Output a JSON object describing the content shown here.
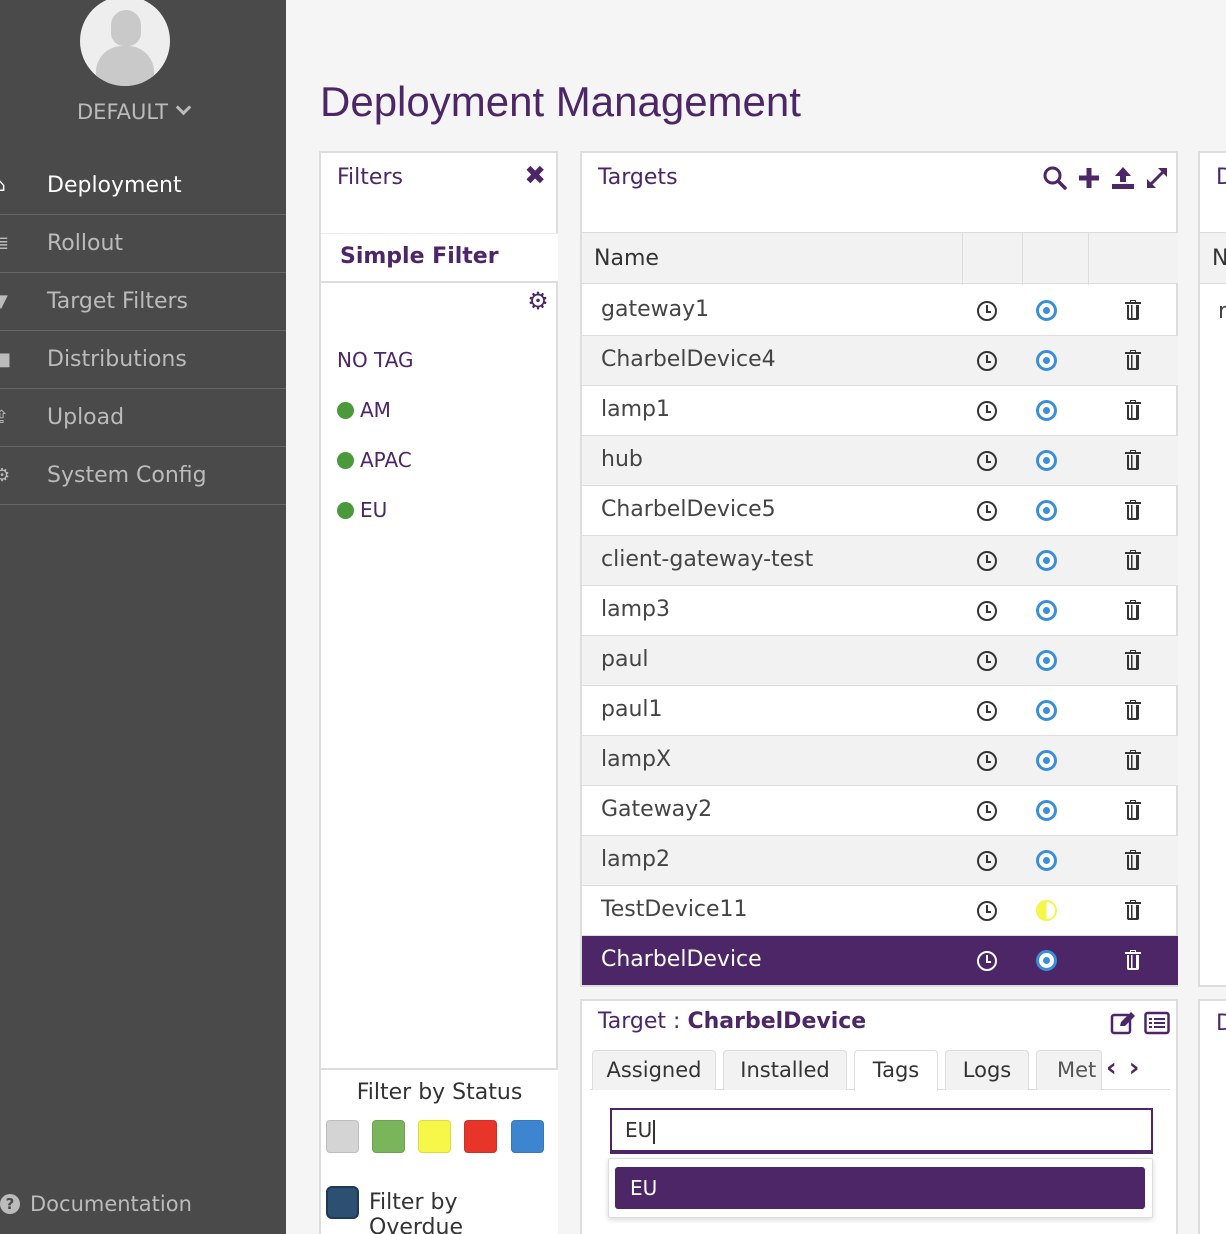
{
  "sidebar": {
    "tenant": "DEFAULT",
    "nav": [
      {
        "label": "Deployment",
        "icon": "home-icon",
        "active": true
      },
      {
        "label": "Rollout",
        "icon": "list-icon",
        "active": false
      },
      {
        "label": "Target Filters",
        "icon": "filter-icon",
        "active": false
      },
      {
        "label": "Distributions",
        "icon": "briefcase-icon",
        "active": false
      },
      {
        "label": "Upload",
        "icon": "upload-icon",
        "active": false
      },
      {
        "label": "System Config",
        "icon": "gear-icon",
        "active": false
      }
    ],
    "documentation": "Documentation"
  },
  "page": {
    "title": "Deployment Management"
  },
  "filters": {
    "title": "Filters",
    "tab": "Simple Filter",
    "tags": [
      {
        "label": "NO TAG",
        "color": null
      },
      {
        "label": "AM",
        "color": "#4a9a3b"
      },
      {
        "label": "APAC",
        "color": "#4a9a3b"
      },
      {
        "label": "EU",
        "color": "#4a9a3b"
      }
    ],
    "status_title": "Filter by Status",
    "status_colors": [
      "#d4d4d4",
      "#7ab55c",
      "#f7f74a",
      "#e8352a",
      "#3d86cf"
    ],
    "overdue_label": "Filter by Overdue"
  },
  "targets": {
    "title": "Targets",
    "column_name": "Name",
    "rows": [
      {
        "name": "gateway1",
        "status": "ok"
      },
      {
        "name": "CharbelDevice4",
        "status": "ok"
      },
      {
        "name": "lamp1",
        "status": "ok"
      },
      {
        "name": "hub",
        "status": "ok"
      },
      {
        "name": "CharbelDevice5",
        "status": "ok"
      },
      {
        "name": "client-gateway-test",
        "status": "ok"
      },
      {
        "name": "lamp3",
        "status": "ok"
      },
      {
        "name": "paul",
        "status": "ok"
      },
      {
        "name": "paul1",
        "status": "ok"
      },
      {
        "name": "lampX",
        "status": "ok"
      },
      {
        "name": "Gateway2",
        "status": "ok"
      },
      {
        "name": "lamp2",
        "status": "ok"
      },
      {
        "name": "TestDevice11",
        "status": "pending"
      },
      {
        "name": "CharbelDevice",
        "status": "ok",
        "selected": true
      }
    ]
  },
  "details": {
    "prefix": "Target : ",
    "target": "CharbelDevice",
    "tabs": [
      "Assigned",
      "Installed",
      "Tags",
      "Logs",
      "Met"
    ],
    "active_tab": "Tags",
    "tag_input_value": "EU",
    "suggestion": "EU"
  },
  "right_panel": {
    "title_top": "D",
    "header": "N",
    "row": "r",
    "title_bottom": "D"
  }
}
